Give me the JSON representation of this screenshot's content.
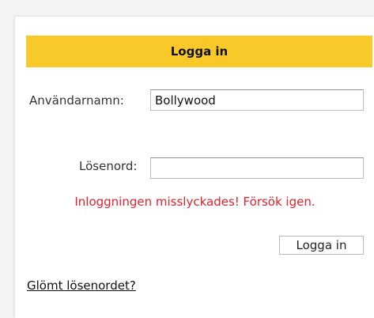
{
  "login": {
    "header": "Logga in",
    "username_label": "Användarnamn:",
    "username_value": "Bollywood",
    "password_label": "Lösenord:",
    "password_value": "",
    "error_message": "Inloggningen misslyckades! Försök igen.",
    "submit_label": "Logga in",
    "forgot_link": "Glömt lösenordet?"
  },
  "colors": {
    "header_background": "#f8c929",
    "error_text": "#e8202a"
  }
}
